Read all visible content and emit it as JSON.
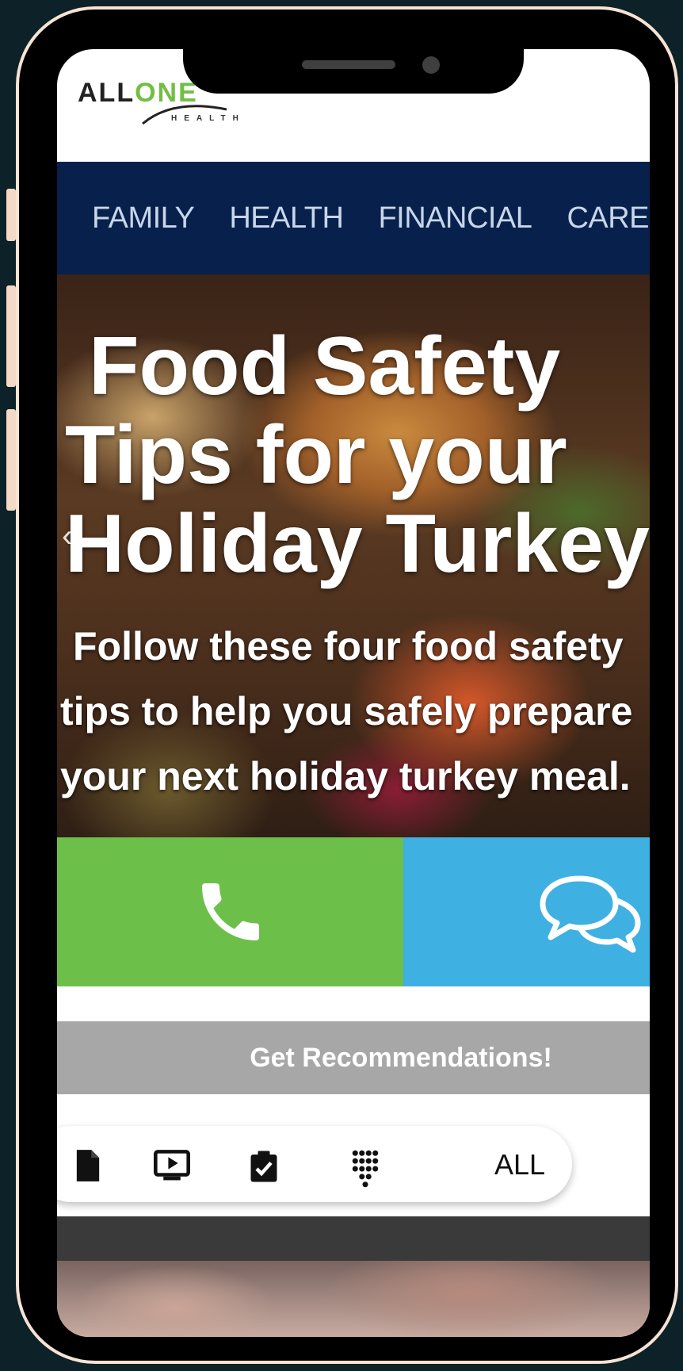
{
  "brand": {
    "logo_main": "ALL",
    "logo_accent": "ONE",
    "logo_sub": "HEALTH"
  },
  "nav": {
    "items": [
      "FAMILY",
      "HEALTH",
      "FINANCIAL",
      "CARE"
    ]
  },
  "hero": {
    "title_lines": [
      "Food Safety",
      "Tips for your",
      "Holiday Turkey"
    ],
    "subtitle_lines": [
      "Follow these four food safety",
      "tips to help you safely prepare",
      "your next holiday turkey meal."
    ],
    "prev_arrow": "‹"
  },
  "actions": {
    "call_icon": "phone-icon",
    "chat_icon": "chat-bubbles-icon",
    "call_color": "#6cc04a",
    "chat_color": "#3eb0e2"
  },
  "recommendations": {
    "label": "Get Recommendations!"
  },
  "filters": {
    "icons": [
      "document-icon",
      "video-icon",
      "clipboard-check-icon",
      "keypad-icon"
    ],
    "all_label": "ALL"
  },
  "colors": {
    "nav_bg": "#08214c",
    "accent_green": "#72be45"
  }
}
